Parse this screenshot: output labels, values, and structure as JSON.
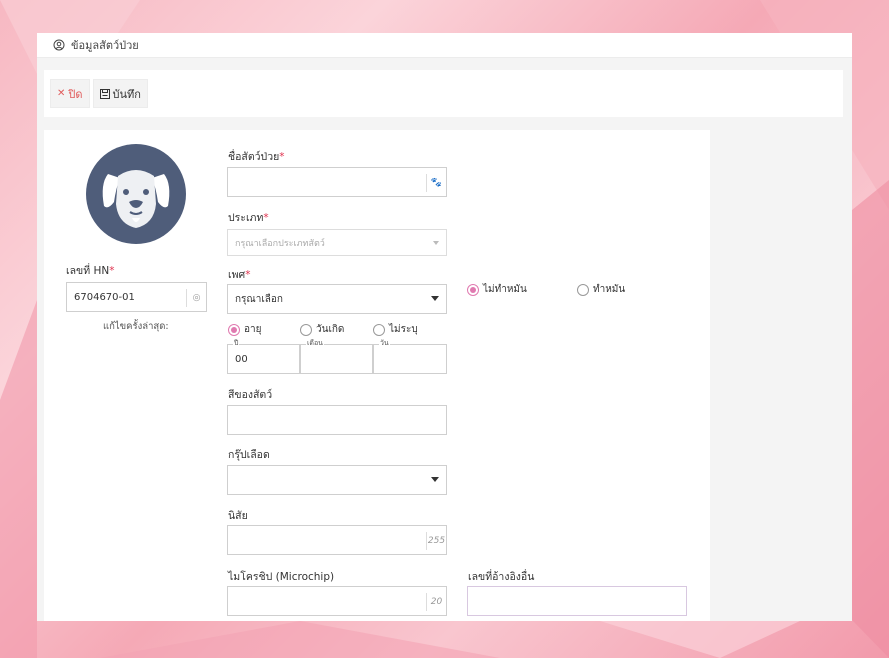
{
  "window": {
    "title": "ข้อมูลสัตว์ป่วย"
  },
  "toolbar": {
    "close_label": "ปิด",
    "save_label": "บันทึก"
  },
  "hn": {
    "label": "เลขที่ HN",
    "value": "6704670-01",
    "last_edit_label": "แก้ไขครั้งล่าสุด:"
  },
  "form": {
    "pet_name": {
      "label": "ชื่อสัตว์ป่วย",
      "value": ""
    },
    "type": {
      "label": "ประเภท",
      "placeholder": "กรุณาเลือกประเภทสัตว์"
    },
    "sex": {
      "label": "เพศ",
      "value": "กรุณาเลือก"
    },
    "neuter": {
      "options": [
        "ไม่ทำหมัน",
        "ทำหมัน"
      ],
      "selected": "ไม่ทำหมัน"
    },
    "age_mode": {
      "options": [
        "อายุ",
        "วันเกิด",
        "ไม่ระบุ"
      ],
      "selected": "อายุ"
    },
    "age": {
      "year_label": "ปี",
      "year_value": "00",
      "month_label": "เดือน",
      "month_value": "",
      "day_label": "วัน",
      "day_value": ""
    },
    "color": {
      "label": "สีของสัตว์",
      "value": ""
    },
    "blood_group": {
      "label": "กรุ๊ปเลือด",
      "value": ""
    },
    "habit": {
      "label": "นิสัย",
      "value": "",
      "max_length": "255"
    },
    "microchip": {
      "label": "ไมโครชิป (Microchip)",
      "value": "",
      "max_length": "20"
    },
    "other_ref": {
      "label": "เลขที่อ้างอิงอื่น",
      "value": ""
    }
  },
  "colors": {
    "accent": "#e07ab0",
    "required": "#e0334f",
    "avatar_bg": "#4f5d7a"
  },
  "icons": {
    "title": "user-circle-icon",
    "close": "x-icon",
    "save": "save-icon",
    "paw": "paw-icon",
    "scan": "scan-icon"
  }
}
